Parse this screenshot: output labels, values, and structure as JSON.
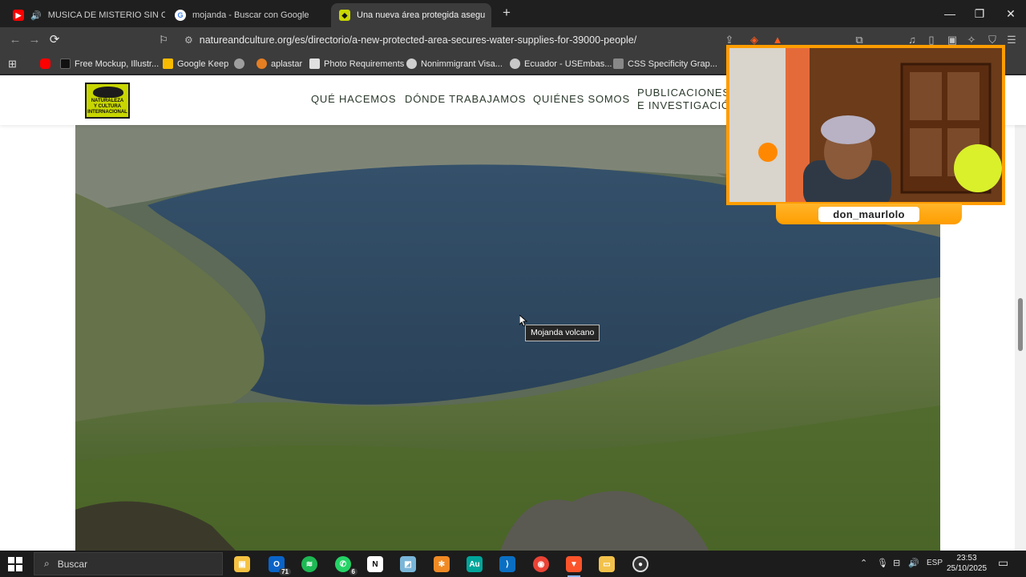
{
  "browser": {
    "tabs": [
      {
        "title": "MUSICA DE MISTERIO SIN COPY",
        "icon": "youtube-icon",
        "audio": true
      },
      {
        "title": "mojanda - Buscar con Google",
        "icon": "google-icon"
      },
      {
        "title": "Una nueva área protegida asegu",
        "icon": "natureandculture-icon",
        "active": true
      }
    ],
    "url": "natureandculture.org/es/directorio/a-new-protected-area-secures-water-supplies-for-39000-people/",
    "bookmarks": [
      {
        "label": "",
        "icon": "youtube-bookmark-icon",
        "color": "#ff0000"
      },
      {
        "label": "Free Mockup, Illustr...",
        "icon": "mockup-icon",
        "color": "#111111"
      },
      {
        "label": "Google Keep",
        "icon": "keep-icon",
        "color": "#f9bb00"
      },
      {
        "label": "",
        "icon": "globe-icon",
        "color": "#9e9e9e"
      },
      {
        "label": "aplastar",
        "icon": "aplastar-icon",
        "color": "#e67e22"
      },
      {
        "label": "Photo Requirements",
        "icon": "photo-req-icon",
        "color": "#e0e0e0"
      },
      {
        "label": "Nonimmigrant Visa...",
        "icon": "visa-icon",
        "color": "#d0d0d0"
      },
      {
        "label": "Ecuador - USEmbas...",
        "icon": "embassy-icon",
        "color": "#c8c8c8"
      },
      {
        "label": "CSS Specificity Grap...",
        "icon": "css-icon",
        "color": "#888888"
      }
    ]
  },
  "site": {
    "logo_lines": [
      "NATURALEZA",
      "Y CULTURA",
      "INTERNACIONAL"
    ],
    "nav": [
      "QUÉ HACEMOS",
      "DÓNDE TRABAJAMOS",
      "QUIÉNES SOMOS",
      "PUBLICACIONES",
      "E INVESTIGACIÓN"
    ],
    "image_caption": "Mojanda volcano"
  },
  "webcam": {
    "username": "don_maurlolo"
  },
  "taskbar": {
    "search_placeholder": "Buscar",
    "badges": {
      "outlook": "71",
      "whatsapp": "6"
    },
    "language": "ESP",
    "time": "23:53",
    "date": "25/10/2025"
  },
  "colors": {
    "accent_orange": "#ff9d00",
    "logo_lime": "#c8d600",
    "nav_text": "#2b3a2c"
  }
}
